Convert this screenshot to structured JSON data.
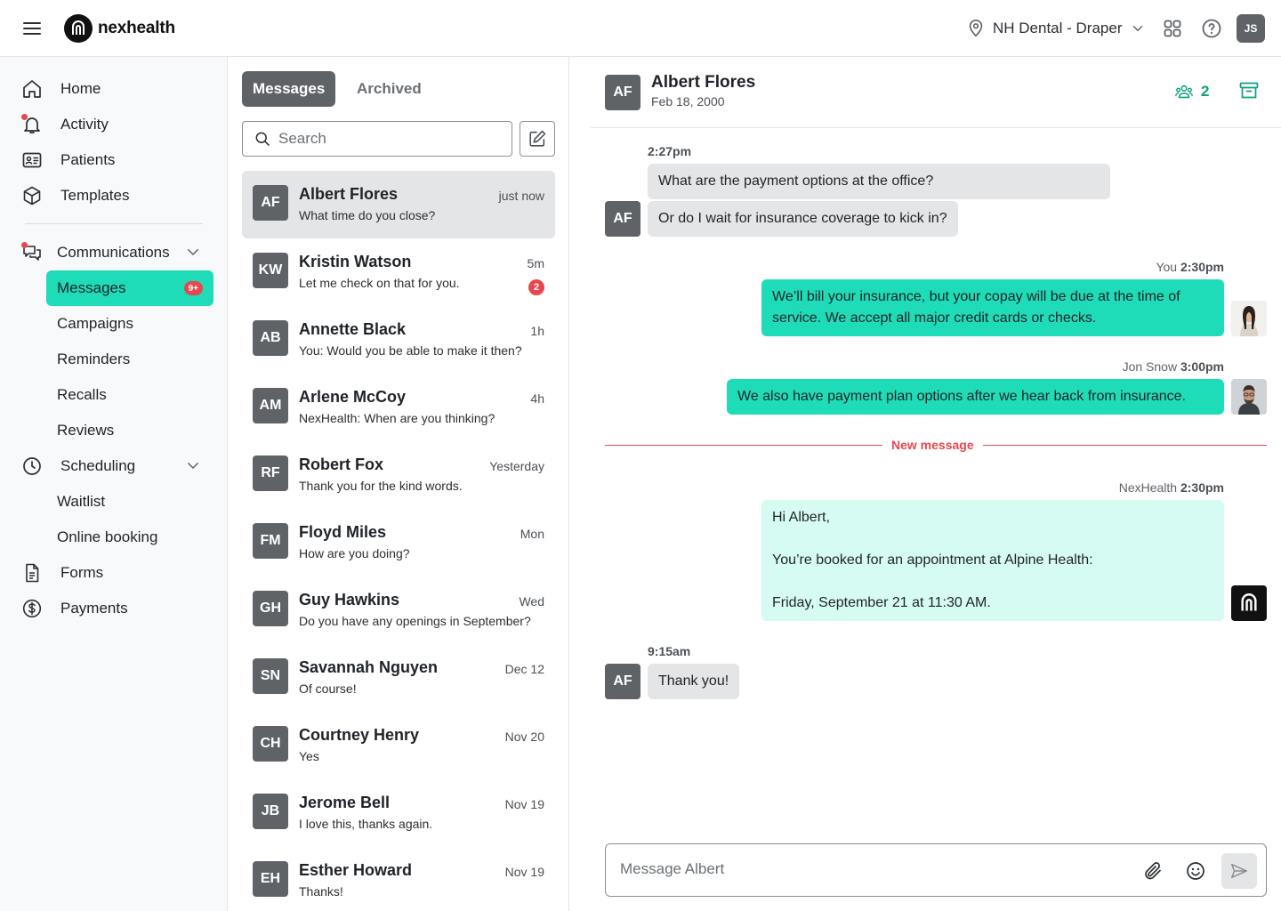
{
  "app": {
    "logo_text": "nexhealth"
  },
  "header": {
    "location": "NH Dental - Draper",
    "user_initials": "JS"
  },
  "sidebar": {
    "home": "Home",
    "activity": "Activity",
    "patients": "Patients",
    "templates": "Templates",
    "communications": "Communications",
    "messages": "Messages",
    "messages_badge": "9+",
    "campaigns": "Campaigns",
    "reminders": "Reminders",
    "recalls": "Recalls",
    "reviews": "Reviews",
    "scheduling": "Scheduling",
    "waitlist": "Waitlist",
    "online_booking": "Online booking",
    "forms": "Forms",
    "payments": "Payments"
  },
  "list": {
    "tab_messages": "Messages",
    "tab_archived": "Archived",
    "search_placeholder": "Search",
    "conversations": [
      {
        "initials": "AF",
        "name": "Albert Flores",
        "preview": "What time do you close?",
        "time": "just now"
      },
      {
        "initials": "KW",
        "name": "Kristin Watson",
        "preview": "Let me check on that for you.",
        "time": "5m",
        "unread": "2"
      },
      {
        "initials": "AB",
        "name": "Annette Black",
        "preview": "You: Would you be able to make it then?",
        "time": "1h"
      },
      {
        "initials": "AM",
        "name": "Arlene McCoy",
        "preview": "NexHealth: When are you thinking?",
        "time": "4h"
      },
      {
        "initials": "RF",
        "name": "Robert Fox",
        "preview": "Thank you for the kind words.",
        "time": "Yesterday"
      },
      {
        "initials": "FM",
        "name": "Floyd Miles",
        "preview": "How are you doing?",
        "time": "Mon"
      },
      {
        "initials": "GH",
        "name": "Guy Hawkins",
        "preview": "Do you have any openings in September?",
        "time": "Wed"
      },
      {
        "initials": "SN",
        "name": "Savannah Nguyen",
        "preview": "Of course!",
        "time": "Dec 12"
      },
      {
        "initials": "CH",
        "name": "Courtney Henry",
        "preview": "Yes",
        "time": "Nov 20"
      },
      {
        "initials": "JB",
        "name": "Jerome Bell",
        "preview": "I love this, thanks again.",
        "time": "Nov 19"
      },
      {
        "initials": "EH",
        "name": "Esther Howard",
        "preview": "Thanks!",
        "time": "Nov 19"
      }
    ]
  },
  "chat": {
    "initials": "AF",
    "name": "Albert Flores",
    "dob": "Feb 18, 2000",
    "participants_count": "2",
    "messages": [
      {
        "time": "2:27pm"
      },
      {
        "text": "What are the payment options at the office?"
      },
      {
        "text": "Or do I wait for insurance coverage to kick in?"
      },
      {
        "sender": "You",
        "time": "2:30pm",
        "text": "We’ll bill your insurance, but your copay will be due at the time of service. We accept all major credit cards or checks."
      },
      {
        "sender": "Jon Snow",
        "time": "3:00pm",
        "text": "We also have payment plan options after we hear back from insurance."
      },
      {
        "sender": "NexHealth",
        "time": "2:30pm",
        "line1": "Hi Albert,",
        "line2": "You’re booked for an appointment at Alpine Health:",
        "line3": "Friday, September 21 at 11:30 AM."
      },
      {
        "time": "9:15am",
        "text": "Thank you!"
      }
    ],
    "new_message_label": "New message",
    "composer_placeholder": "Message Albert"
  }
}
